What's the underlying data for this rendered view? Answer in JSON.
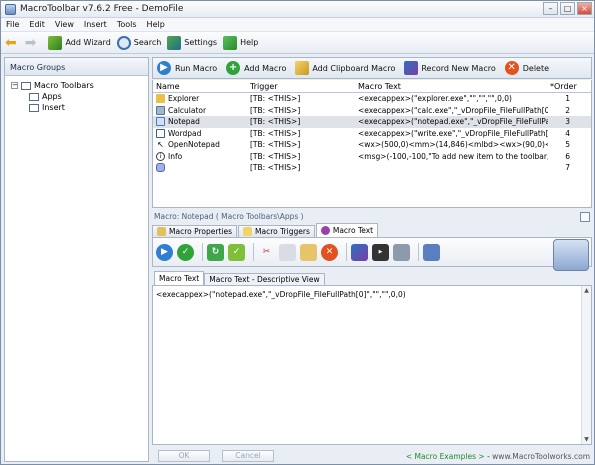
{
  "window": {
    "title": "MacroToolbar v7.6.2 Free - DemoFile"
  },
  "menu": {
    "items": [
      "File",
      "Edit",
      "View",
      "Insert",
      "Tools",
      "Help"
    ]
  },
  "toolbar": {
    "add_wizard": "Add Wizard",
    "search": "Search",
    "settings": "Settings",
    "help": "Help"
  },
  "left_pane": {
    "header": "Macro Groups",
    "tree": {
      "root": "Macro Toolbars",
      "children": [
        "Apps",
        "Insert"
      ]
    }
  },
  "right_toolbar": {
    "run_macro": "Run Macro",
    "add_macro": "Add Macro",
    "add_clipboard_macro": "Add Clipboard Macro",
    "record_new_macro": "Record New Macro",
    "delete": "Delete"
  },
  "grid": {
    "columns": [
      "Name",
      "Trigger",
      "Macro Text",
      "*Order"
    ],
    "rows": [
      {
        "name": "Explorer",
        "trigger": "[TB: <THIS>]",
        "text": "<execappex>(\"explorer.exe\",\"\",\"\",\"\",0,0)",
        "order": "1"
      },
      {
        "name": "Calculator",
        "trigger": "[TB: <THIS>]",
        "text": "<execappex>(\"calc.exe\",\"_vDropFile_FileFullPath[0]\",\"...",
        "order": "2"
      },
      {
        "name": "Notepad",
        "trigger": "[TB: <THIS>]",
        "text": "<execappex>(\"notepad.exe\",\"_vDropFile_FileFullPath[0]...",
        "order": "3"
      },
      {
        "name": "Wordpad",
        "trigger": "[TB: <THIS>]",
        "text": "<execappex>(\"write.exe\",\"_vDropFile_FileFullPath[0]\",\"...",
        "order": "4"
      },
      {
        "name": "OpenNotepad",
        "trigger": "[TB: <THIS>]",
        "text": "<wx>(500,0)<mm>(14,846)<mlbd><wx>(90,0)<mlbu><wx...",
        "order": "5"
      },
      {
        "name": "Info",
        "trigger": "[TB: <THIS>]",
        "text": "<msg>(-100,-100,\"To add new item to the toolbar, just dr...",
        "order": "6"
      },
      {
        "name": "",
        "trigger": "[TB: <THIS>]",
        "text": "",
        "order": "7"
      }
    ]
  },
  "lower": {
    "title": "Macro: Notepad ( Macro Toolbars\\Apps )",
    "tabs": [
      "Macro Properties",
      "Macro Triggers",
      "Macro Text"
    ],
    "subtabs": [
      "Macro Text",
      "Macro Text - Descriptive View"
    ],
    "editor_text": "<execappex>(\"notepad.exe\",\"_vDropFile_FileFullPath[0]\",\"\",\"\",0,0)"
  },
  "status": {
    "ok": "OK",
    "cancel": "Cancel",
    "macro_examples": "< Macro Examples >",
    "site": "www.MacroToolworks.com"
  }
}
